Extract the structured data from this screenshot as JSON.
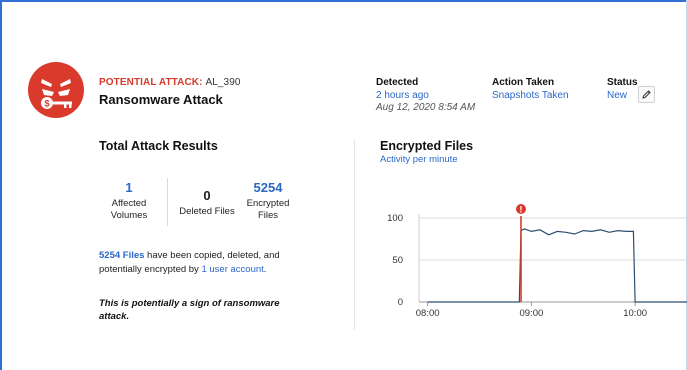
{
  "alert": {
    "prefix": "POTENTIAL ATTACK:",
    "id": "AL_390",
    "title": "Ransomware Attack"
  },
  "meta": {
    "detected_label": "Detected",
    "detected_relative": "2 hours ago",
    "detected_date": "Aug 12, 2020 8:54 AM",
    "action_label": "Action Taken",
    "action_value": "Snapshots Taken",
    "status_label": "Status",
    "status_value": "New"
  },
  "results": {
    "title": "Total Attack Results",
    "stats": [
      {
        "value": "1",
        "label_line1": "Affected",
        "label_line2": "Volumes"
      },
      {
        "value": "0",
        "label_line1": "Deleted Files",
        "label_line2": ""
      },
      {
        "value": "5254",
        "label_line1": "Encrypted",
        "label_line2": "Files"
      }
    ],
    "summary_files": "5254 Files",
    "summary_mid": " have been copied, deleted, and potentially encrypted by ",
    "summary_link": "1 user account",
    "summary_end": ".",
    "note": "This is potentially a sign of ransomware attack."
  },
  "encrypted_chart": {
    "title": "Encrypted Files",
    "subtitle": "Activity per minute",
    "alert_marker": "!"
  },
  "colors": {
    "accent": "#2b67c9",
    "danger": "#d93a2b",
    "series": "#2f4f6f"
  },
  "chart_data": {
    "type": "line",
    "title": "Encrypted Files",
    "subtitle": "Activity per minute",
    "x_ticks": [
      "08:00",
      "09:00",
      "10:00"
    ],
    "y_ticks": [
      0,
      50,
      100
    ],
    "ylim": [
      0,
      100
    ],
    "xlim_minutes_from_0800": [
      -5,
      150
    ],
    "grid": true,
    "alert_marker_x": "08:54",
    "series": [
      {
        "x": [
          "08:00",
          "08:50",
          "08:53",
          "08:54",
          "08:56",
          "09:00",
          "09:05",
          "09:10",
          "09:15",
          "09:20",
          "09:25",
          "09:30",
          "09:35",
          "09:40",
          "09:45",
          "09:50",
          "09:55",
          "09:58",
          "09:59",
          "10:00",
          "10:30"
        ],
        "values": [
          0,
          0,
          0,
          85,
          87,
          84,
          86,
          80,
          84,
          83,
          81,
          85,
          84,
          86,
          83,
          85,
          84,
          84,
          84,
          0,
          0
        ]
      }
    ]
  }
}
